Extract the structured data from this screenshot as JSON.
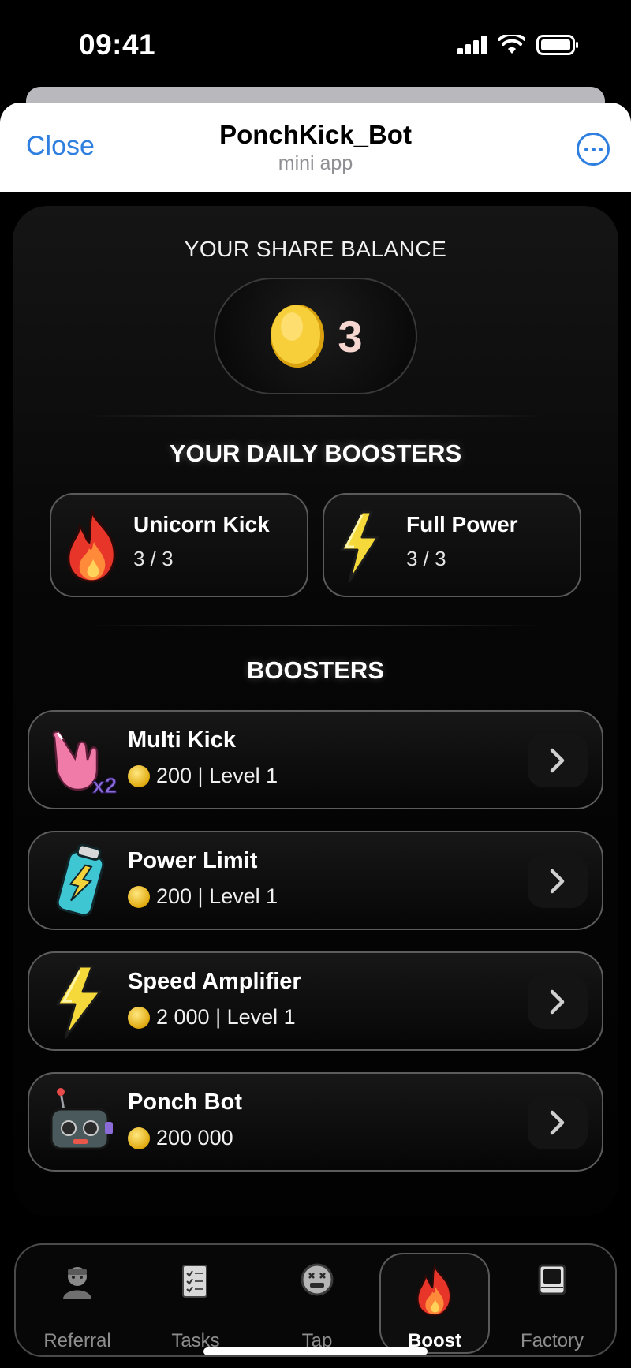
{
  "status_bar": {
    "time": "09:41"
  },
  "header": {
    "close_label": "Close",
    "title": "PonchKick_Bot",
    "subtitle": "mini app"
  },
  "balance": {
    "label": "YOUR SHARE BALANCE",
    "value": "3"
  },
  "daily_boosters": {
    "title": "YOUR DAILY BOOSTERS",
    "items": [
      {
        "name": "Unicorn Kick",
        "count": "3 / 3",
        "icon": "fire-icon"
      },
      {
        "name": "Full Power",
        "count": "3 / 3",
        "icon": "lightning-icon"
      }
    ]
  },
  "boosters": {
    "title": "BOOSTERS",
    "items": [
      {
        "name": "Multi Kick",
        "price": "200 | Level 1",
        "icon": "multi-kick-hand-icon"
      },
      {
        "name": "Power Limit",
        "price": "200 | Level 1",
        "icon": "battery-can-icon"
      },
      {
        "name": "Speed Amplifier",
        "price": "2 000 | Level 1",
        "icon": "lightning-icon"
      },
      {
        "name": "Ponch Bot",
        "price": "200 000",
        "icon": "robot-icon"
      }
    ]
  },
  "tabs": [
    {
      "label": "Referral",
      "icon": "referral-icon",
      "active": false
    },
    {
      "label": "Tasks",
      "icon": "tasks-icon",
      "active": false
    },
    {
      "label": "Tap",
      "icon": "tap-icon",
      "active": false
    },
    {
      "label": "Boost",
      "icon": "fire-icon",
      "active": true
    },
    {
      "label": "Factory",
      "icon": "factory-icon",
      "active": false
    }
  ],
  "colors": {
    "accent_blue": "#2f7fe0",
    "coin_gold": "#f2c12e",
    "background": "#000000"
  }
}
